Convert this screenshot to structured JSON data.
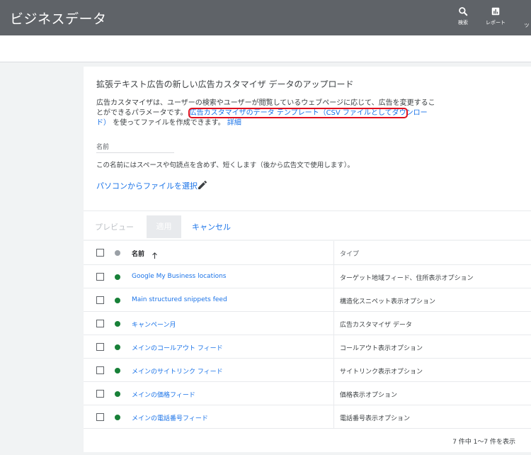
{
  "app": {
    "title": "ビジネスデータ"
  },
  "header": {
    "search_label": "検索",
    "reports_label": "レポート",
    "tools_label": "ツ"
  },
  "upload": {
    "title": "拡張テキスト広告の新しい広告カスタマイザ データのアップロード",
    "desc_part1": "広告カスタマイザは、ユーザーの検索やユーザーが閲覧しているウェブページに応じて、広告を変更することができるパラメータです。",
    "template_link": "広告カスタマイザのデータ テンプレート（CSV ファイルとしてダウ",
    "template_link_cont": "ンロード）",
    "desc_part2": "を使ってファイルを作成できます。",
    "more_link": "詳細",
    "name_label": "名前",
    "name_hint": "この名前にはスペースや句読点を含めず、短くします（後から広告文で使用します）。",
    "choose_file": "パソコンからファイルを選択",
    "preview_label": "プレビュー",
    "apply_label": "適用",
    "cancel_label": "キャンセル"
  },
  "table": {
    "columns": {
      "name": "名前",
      "type": "タイプ"
    },
    "rows": [
      {
        "name": "Google My Business locations",
        "type": "ターゲット地域フィード、住所表示オプション"
      },
      {
        "name": "Main structured snippets feed",
        "type": "構造化スニペット表示オプション"
      },
      {
        "name": "キャンペーン月",
        "type": "広告カスタマイザ データ"
      },
      {
        "name": "メインのコールアウト フィード",
        "type": "コールアウト表示オプション"
      },
      {
        "name": "メインのサイトリンク フィード",
        "type": "サイトリンク表示オプション"
      },
      {
        "name": "メインの価格フィード",
        "type": "価格表示オプション"
      },
      {
        "name": "メインの電話番号フィード",
        "type": "電話番号表示オプション"
      }
    ],
    "pagination": "7 件中 1～7 件を表示"
  },
  "colors": {
    "accent": "#1a73e8",
    "header_bg": "#5f6368",
    "status_green": "#188038",
    "highlight_red": "#e0101e"
  }
}
